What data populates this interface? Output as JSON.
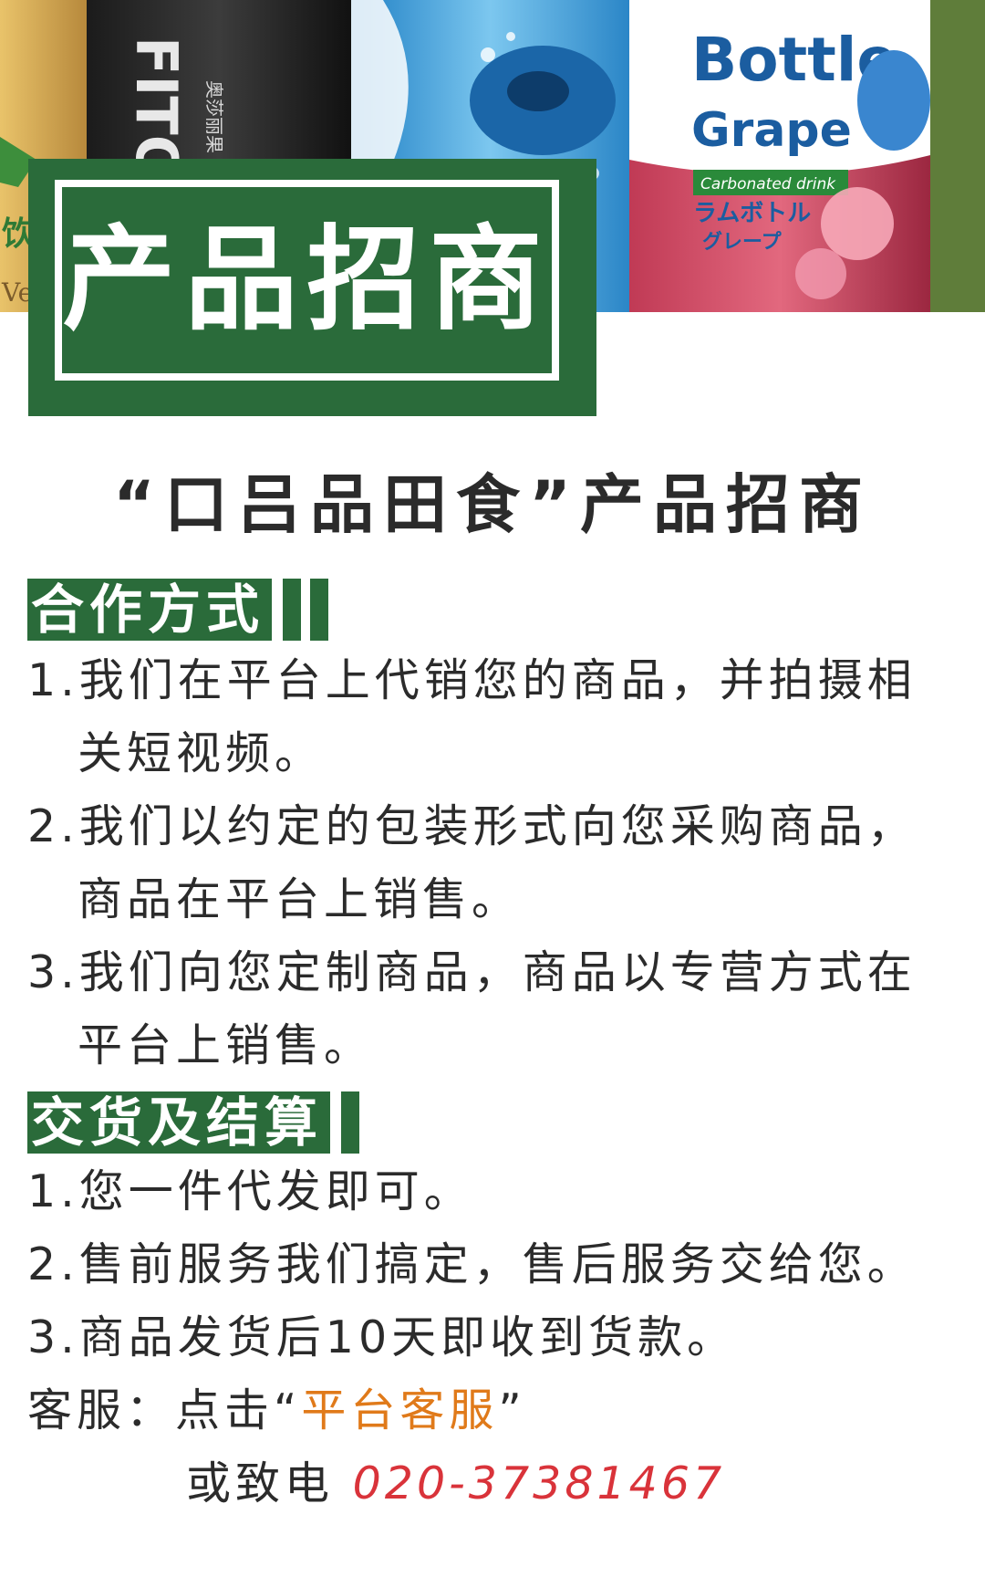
{
  "hero": {
    "bottle_fito": "FITO",
    "bottle_fito_cn": "奥莎丽果",
    "bottle_bottle": "Bottle",
    "bottle_grape": "Grape",
    "bottle_carbonated": "Carbonated drink",
    "bottle_jp1": "ラムボトル",
    "bottle_jp2": "グレープ",
    "left_cn": "饮",
    "left_ver": "Ver"
  },
  "badge": {
    "title": "产品招商"
  },
  "page_heading": "“口吕品田食”产品招商",
  "sections": [
    {
      "label": "合作方式",
      "items": [
        {
          "num": "1.",
          "line1": "我们在平台上代销您的商品，并拍摄相",
          "line2": "关短视频。"
        },
        {
          "num": "2.",
          "line1": "我们以约定的包装形式向您采购商品，",
          "line2": "商品在平台上销售。"
        },
        {
          "num": "3.",
          "line1": "我们向您定制商品，商品以专营方式在",
          "line2": "平台上销售。"
        }
      ]
    },
    {
      "label": "交货及结算",
      "items": [
        {
          "num": "1.",
          "line1": "您一件代发即可。"
        },
        {
          "num": "2.",
          "line1": "售前服务我们搞定，售后服务交给您。"
        },
        {
          "num": "3.",
          "line1": "商品发货后10天即收到货款。"
        }
      ]
    }
  ],
  "service": {
    "label": "客服：点击",
    "quote_open": "“",
    "link": "平台客服",
    "quote_close": "”",
    "call_prefix": "或致电",
    "phone": "020-37381467"
  },
  "colors": {
    "green": "#2a6b3a",
    "orange": "#e07a1a",
    "red": "#d9333a",
    "text": "#2b2b2b"
  }
}
